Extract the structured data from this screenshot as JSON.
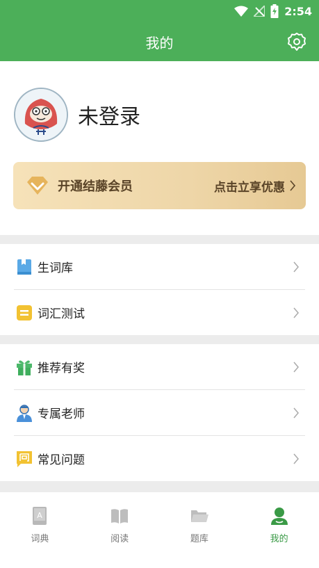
{
  "status_bar": {
    "time": "2:54"
  },
  "header": {
    "title": "我的"
  },
  "profile": {
    "username": "未登录"
  },
  "vip": {
    "title": "开通结藤会员",
    "cta": "点击立享优惠"
  },
  "menu": {
    "group1": [
      {
        "label": "生词库"
      },
      {
        "label": "词汇测试"
      }
    ],
    "group2": [
      {
        "label": "推荐有奖"
      },
      {
        "label": "专属老师"
      },
      {
        "label": "常见问题"
      }
    ]
  },
  "bottom_nav": [
    {
      "label": "词典",
      "icon": "dictionary-icon"
    },
    {
      "label": "阅读",
      "icon": "book-icon"
    },
    {
      "label": "题库",
      "icon": "folder-icon"
    },
    {
      "label": "我的",
      "icon": "user-icon",
      "active": true
    }
  ],
  "colors": {
    "brand": "#4caf59",
    "active_nav": "#3a9a46",
    "vip_text": "#5a4428"
  }
}
